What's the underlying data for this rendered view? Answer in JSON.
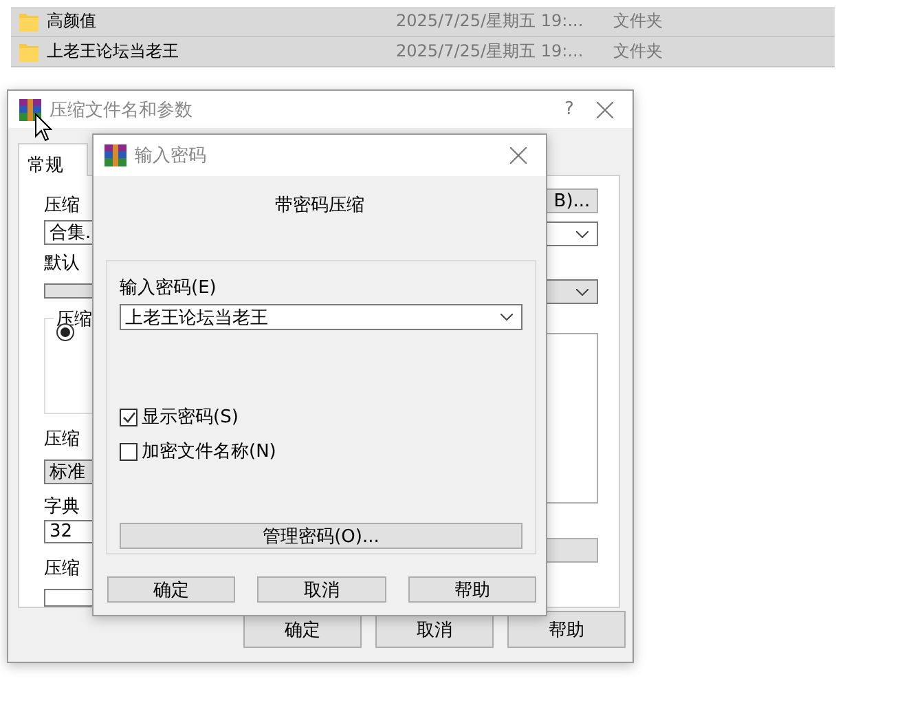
{
  "file_list": [
    {
      "name": "高颜值",
      "modified": "2025/7/25/星期五 19:...",
      "type": "文件夹"
    },
    {
      "name": "上老王论坛当老王",
      "modified": "2025/7/25/星期五 19:...",
      "type": "文件夹"
    }
  ],
  "archive_dialog": {
    "title": "压缩文件名和参数",
    "help_button": "?",
    "tabs": [
      {
        "label": "常规",
        "selected": true
      }
    ],
    "fields": [
      {
        "kind": "combo",
        "label": "压缩",
        "value": "合集."
      },
      {
        "kind": "list",
        "label": "默认"
      },
      {
        "kind": "group",
        "label": "压缩",
        "radio_selected": true
      },
      {
        "kind": "list",
        "label": "压缩",
        "value": "标准"
      },
      {
        "kind": "field",
        "label": "字典",
        "value": "32"
      },
      {
        "kind": "field",
        "label": "压缩"
      }
    ],
    "browse_button": "B)...",
    "buttons": [
      "确定",
      "取消",
      "帮助"
    ]
  },
  "password_dialog": {
    "title": "输入密码",
    "heading": "带密码压缩",
    "password_label": "输入密码(E)",
    "password_value": "上老王论坛当老王",
    "options": [
      {
        "label": "显示密码(S)",
        "checked": true
      },
      {
        "label": "加密文件名称(N)",
        "checked": false
      }
    ],
    "manage_button": "管理密码(O)...",
    "buttons": [
      "确定",
      "取消",
      "帮助"
    ]
  }
}
